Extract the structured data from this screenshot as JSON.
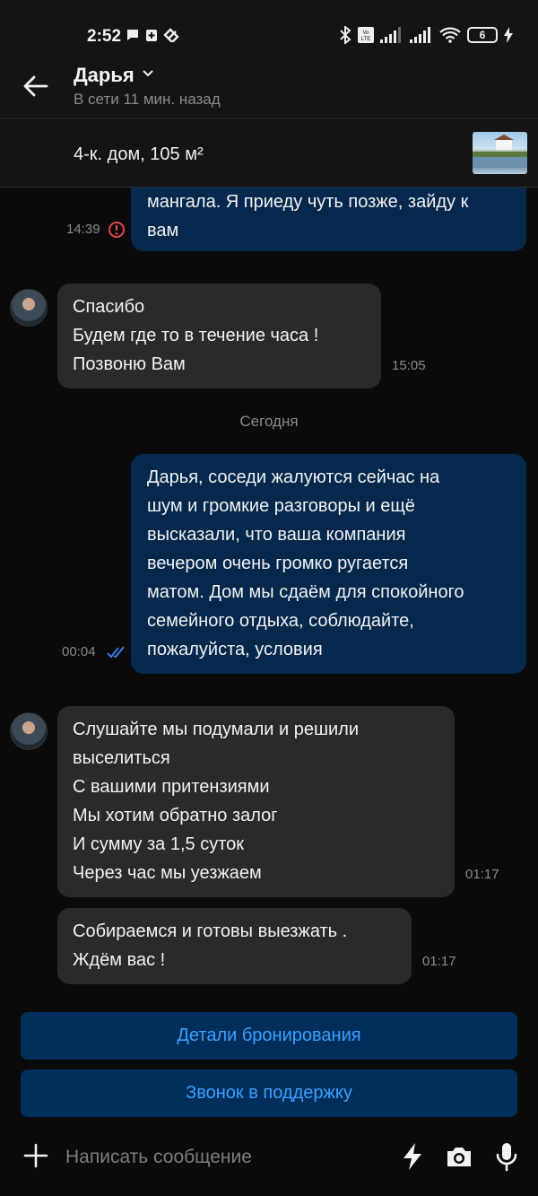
{
  "status_bar": {
    "time": "2:52",
    "battery": "6",
    "icons": [
      "chat-bubble-icon",
      "clipboard-plus-icon",
      "app-icon",
      "bluetooth-icon",
      "volte-icon",
      "signal-icon",
      "signal-icon",
      "wifi-icon",
      "battery-icon",
      "charging-icon"
    ]
  },
  "header": {
    "contact_name": "Дарья",
    "contact_status": "В сети 11 мин. назад"
  },
  "listing": {
    "title": "4-к. дом, 105 м²"
  },
  "messages": [
    {
      "direction": "out",
      "lines": [
        "мангала. Я приеду чуть позже, зайду к",
        "вам"
      ],
      "time": "14:39",
      "status": "error"
    },
    {
      "direction": "in",
      "lines": [
        "Спасибо",
        "Будем где то в течение часа !",
        "Позвоню Вам"
      ],
      "time": "15:05"
    },
    {
      "direction": "out",
      "lines": [
        "Дарья, соседи жалуются сейчас на",
        "шум и  громкие разговоры и ещё",
        "высказали, что ваша компания",
        "вечером очень громко ругается",
        "матом. Дом мы сдаём для спокойного",
        "семейного отдыха, соблюдайте,",
        "пожалуйста, условия"
      ],
      "time": "00:04",
      "status": "read"
    },
    {
      "direction": "in",
      "lines": [
        "Слушайте мы подумали и решили",
        "выселиться",
        "С вашими притензиями",
        "Мы хотим обратно залог",
        "И сумму за 1,5 суток",
        "Через час мы уезжаем"
      ],
      "time": "01:17"
    },
    {
      "direction": "in",
      "lines": [
        "Собираемся и готовы выезжать .",
        "Ждём вас !"
      ],
      "time": "01:17"
    }
  ],
  "date_separator": "Сегодня",
  "actions": {
    "booking_details": "Детали бронирования",
    "support_call": "Звонок в поддержку"
  },
  "composer": {
    "placeholder": "Написать сообщение"
  },
  "colors": {
    "outgoing_bubble": "#05284c",
    "incoming_bubble": "#2a2a2a",
    "action_button_bg": "#022e5b",
    "action_button_text": "#3aa0ff",
    "error": "#e5484d",
    "read_check": "#3b82f6"
  }
}
